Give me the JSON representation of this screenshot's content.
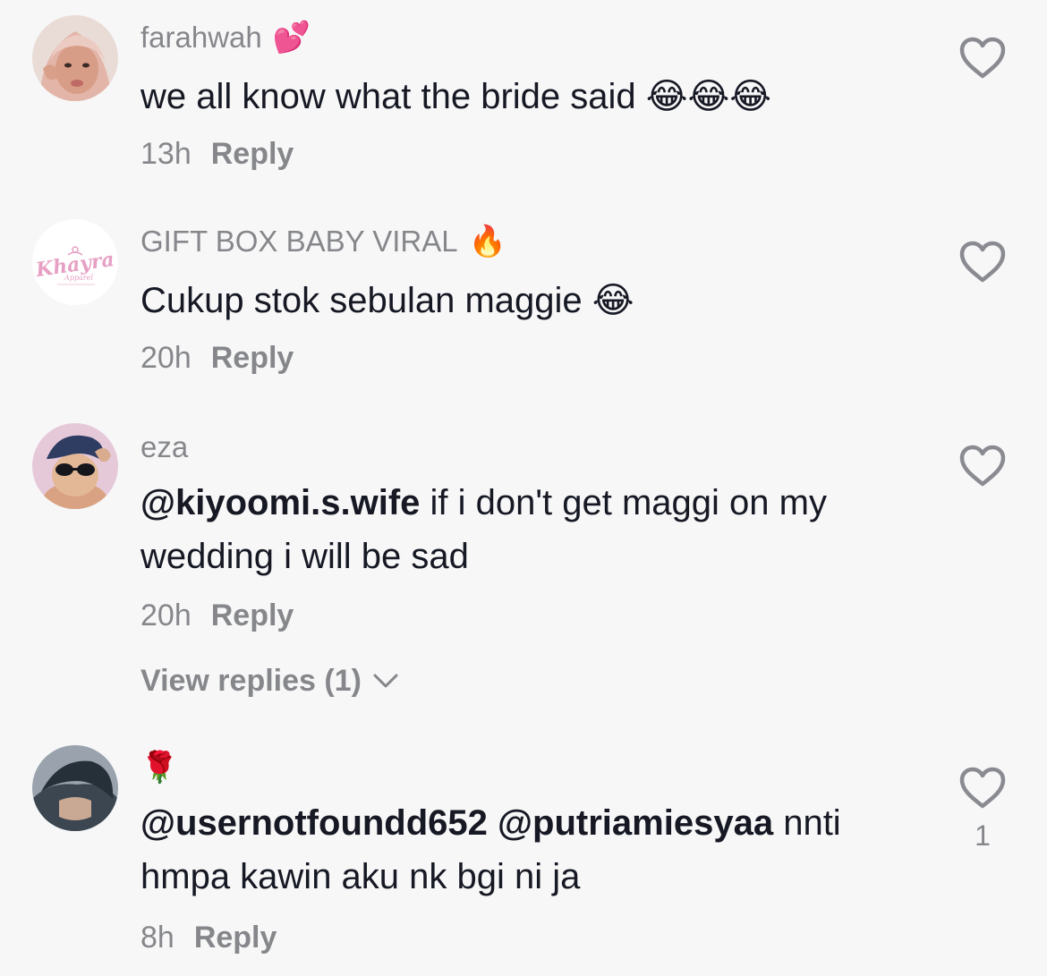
{
  "comments": [
    {
      "username": "farahwah",
      "badge": "💕",
      "text": "we all know what the bride said",
      "emojis": "😂😂😂",
      "time": "13h",
      "reply_label": "Reply"
    },
    {
      "username": "GIFT BOX BABY VIRAL",
      "badge": "🔥",
      "avatar_logo_text": "Khayra",
      "avatar_sub_text": "Apparel",
      "text": "Cukup stok sebulan maggie",
      "emojis": "😂",
      "time": "20h",
      "reply_label": "Reply"
    },
    {
      "username": "eza",
      "mention": "@kiyoomi.s.wife",
      "text": "if i don't get maggi on my wedding i will be sad",
      "time": "20h",
      "reply_label": "Reply",
      "view_replies": "View replies (1)"
    },
    {
      "username": "🌹",
      "mention1": "@usernotfoundd652",
      "mention2": "@putriamiesyaa",
      "text": "nnti hmpa kawin aku nk bgi ni ja",
      "time": "8h",
      "reply_label": "Reply",
      "like_count": "1"
    }
  ],
  "icons": {
    "like": "heart-outline-icon",
    "expand": "chevron-down-icon"
  },
  "colors": {
    "background": "#f7f7f8",
    "secondary_text": "#86878b",
    "primary_text": "#161823",
    "logo_pink": "#e7a0c4"
  }
}
